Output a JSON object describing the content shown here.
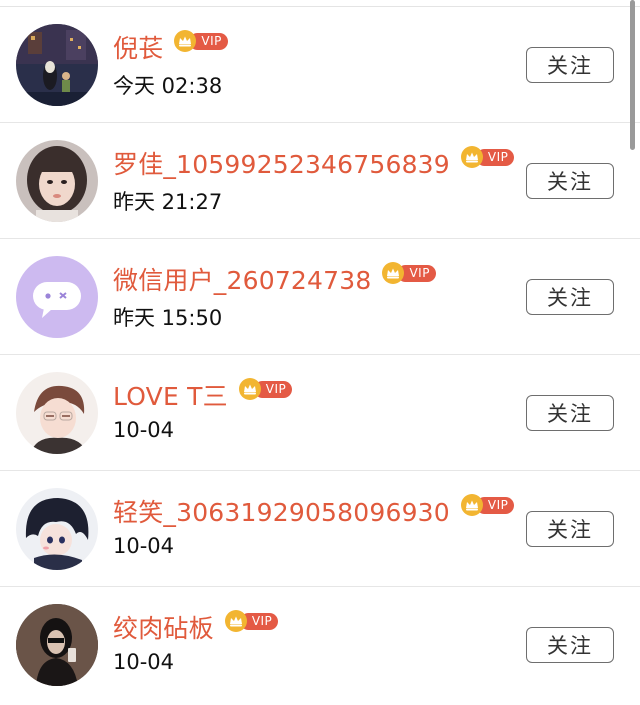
{
  "vip_label": "VIP",
  "colors": {
    "name": "#e05a3c",
    "vip_badge": "#e45a45",
    "crown": "#f2b531",
    "divider": "#e6e6e6"
  },
  "users": [
    {
      "name": "倪苌",
      "time": "今天 02:38",
      "follow_label": "关注",
      "avatar": "dark-painting-avatar"
    },
    {
      "name": "罗佳_10599252346756839",
      "time": "昨天 21:27",
      "follow_label": "关注",
      "avatar": "girl-photo-avatar"
    },
    {
      "name": "微信用户_260724738",
      "time": "昨天 15:50",
      "follow_label": "关注",
      "avatar": "chat-bubble-avatar"
    },
    {
      "name": "LOVE T三",
      "time": "10-04",
      "follow_label": "关注",
      "avatar": "anime-boy-avatar"
    },
    {
      "name": "轻笑_30631929058096930",
      "time": "10-04",
      "follow_label": "关注",
      "avatar": "anime-girl-avatar"
    },
    {
      "name": "绞肉砧板",
      "time": "10-04",
      "follow_label": "关注",
      "avatar": "mirror-selfie-avatar"
    }
  ]
}
